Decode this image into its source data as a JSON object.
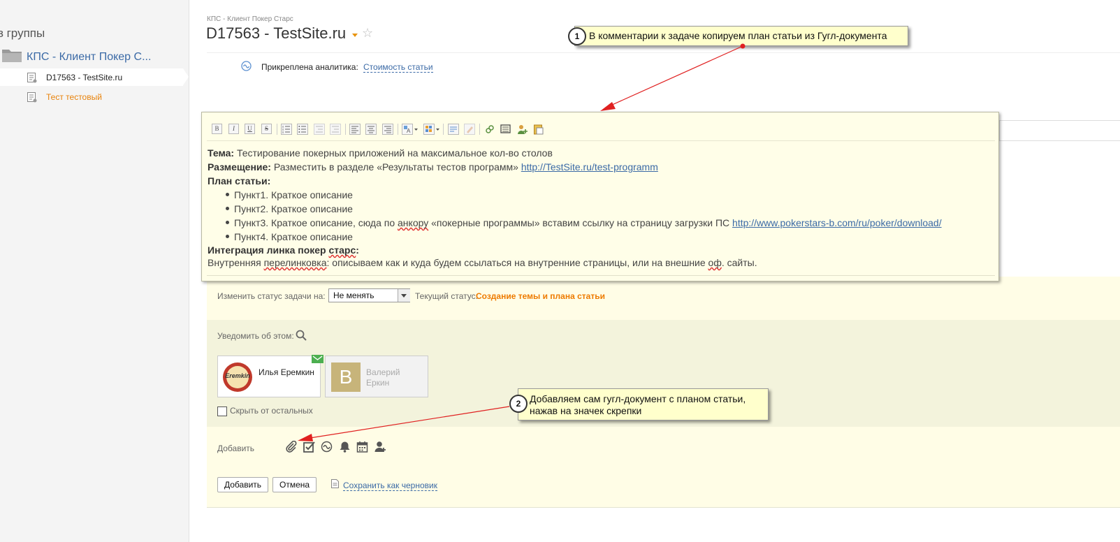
{
  "sidebar": {
    "heading": "ез группы",
    "group_name": "КПС - Клиент Покер С...",
    "items": [
      {
        "label": "D17563 - TestSite.ru"
      },
      {
        "label": "Тест тестовый"
      }
    ]
  },
  "header": {
    "breadcrumb": "КПС - Клиент Покер Старс",
    "title": "D17563 - TestSite.ru",
    "star_glyph": "☆"
  },
  "analytics": {
    "label": "Прикреплена аналитика:",
    "link": "Стоимость статьи"
  },
  "editor": {
    "toolbar": [
      "B",
      "I",
      "U",
      "S"
    ],
    "topic_label": "Тема:",
    "topic_text": "Тестирование покерных приложений на максимальное кол-во столов",
    "placement_label": "Размещение:",
    "placement_text": "Разместить в разделе «Результаты тестов программ»",
    "placement_link": "http://TestSite.ru/test-programm",
    "plan_label": "План статьи:",
    "plan_items": [
      "Пункт1. Краткое описание",
      "Пункт2. Краткое описание",
      "Пункт3. Краткое описание, сюда по",
      "Пункт4. Краткое описание"
    ],
    "item3_word_anchor": "анкору",
    "item3_rest": "«покерные программы» вставим ссылку на страницу загрузки ПС",
    "item3_link": "http://www.pokerstars-b.com/ru/poker/download/",
    "integration_label": "Интеграция линка покер",
    "integration_word": "старс",
    "integration_colon": ":",
    "internal_label": "Внутренняя",
    "internal_word": "перелинковка",
    "internal_text": ": описываем как и куда будем ссылаться на внутренние страницы, или на внешние",
    "internal_word2": "оф",
    "internal_end": ". сайты."
  },
  "status": {
    "change_label": "Изменить статус задачи на:",
    "select_value": "Не менять",
    "current_label": "Текущий статус:",
    "current_value": "Создание темы и плана статьи"
  },
  "notify": {
    "label": "Уведомить об этом:",
    "users": [
      {
        "name": "Илья Еремкин",
        "avatar_text": "Eremkin"
      },
      {
        "name": "Валерий Еркин",
        "initial": "В"
      }
    ],
    "hide_label": "Скрыть от остальных"
  },
  "add": {
    "label": "Добавить"
  },
  "buttons": {
    "add": "Добавить",
    "cancel": "Отмена",
    "save_draft": "Сохранить как черновик"
  },
  "callouts": [
    {
      "number": "1",
      "text": "В комментарии к задаче копируем план статьи из Гугл-документа"
    },
    {
      "number": "2",
      "text": "Добавляем сам гугл-документ с планом статьи, нажав на значек скрепки"
    }
  ],
  "colors": {
    "link": "#3b6aa6",
    "status_orange": "#ee7b00",
    "callout_bg": "#ffffcc",
    "arrow_red": "#e02020"
  }
}
